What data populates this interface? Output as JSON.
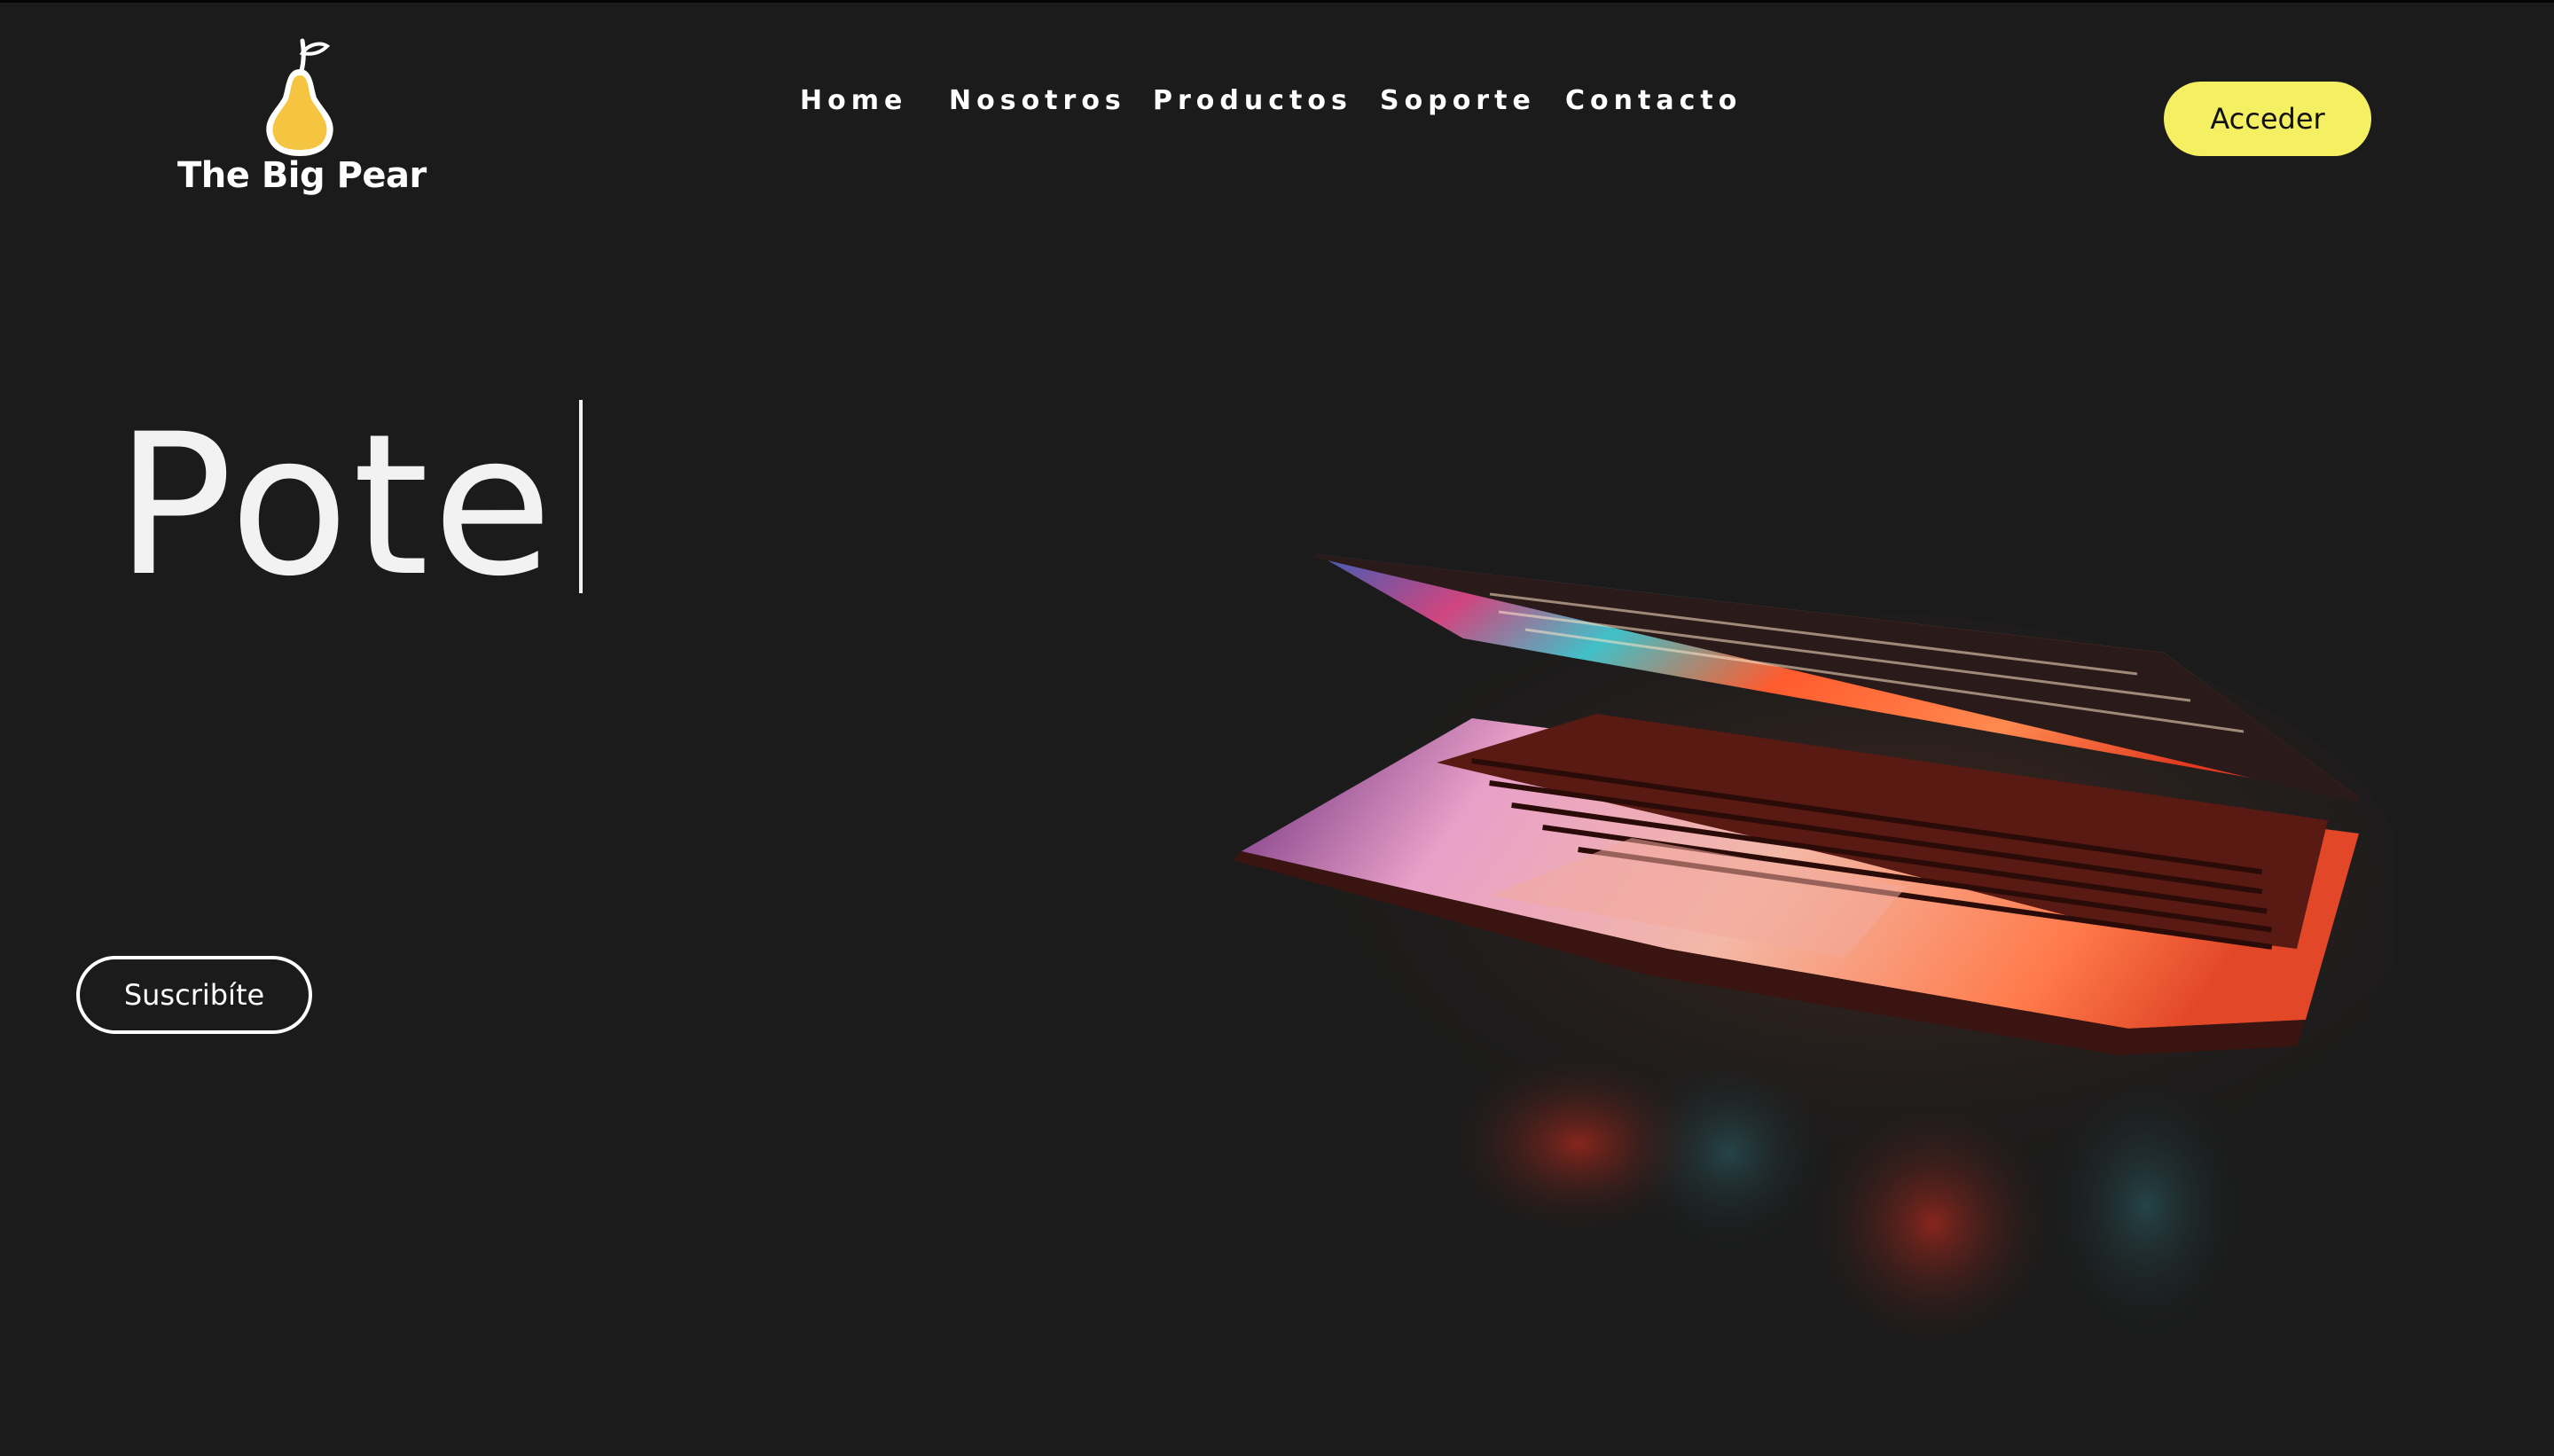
{
  "brand": {
    "name": "The Big Pear",
    "mark_color": "#f5c542"
  },
  "nav": {
    "items": [
      "Home",
      "Nosotros",
      "Productos",
      "Soporte",
      "Contacto"
    ]
  },
  "header": {
    "login_label": "Acceder"
  },
  "hero": {
    "typed_text": "Pote",
    "cta_label": "Suscribíte",
    "image": "laptop-photo"
  },
  "colors": {
    "background": "#1b1b1b",
    "accent": "#f5ef62",
    "text": "#ffffff"
  }
}
